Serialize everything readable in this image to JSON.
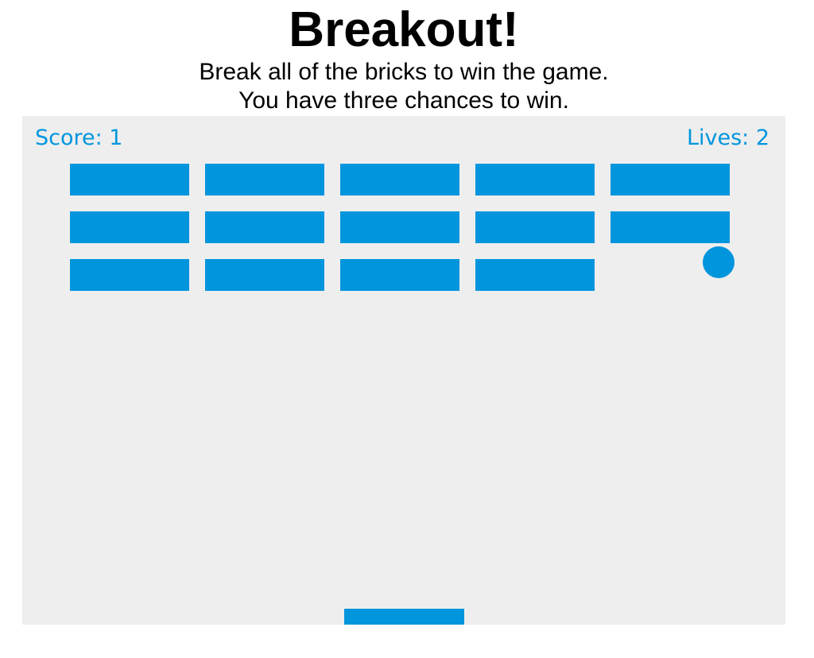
{
  "header": {
    "title": "Breakout!",
    "line1": "Break all of the bricks to win the game.",
    "line2": "You have three chances to win."
  },
  "game": {
    "score_text": "Score: 1",
    "lives_text": "Lives: 2",
    "colors": {
      "background": "#eeeeee",
      "accent": "#0095dd"
    },
    "brick_rows": 3,
    "brick_columns": 5,
    "bricks_present": [
      [
        true,
        true,
        true,
        true,
        true
      ],
      [
        true,
        true,
        true,
        true,
        true
      ],
      [
        true,
        true,
        true,
        true,
        false
      ]
    ]
  }
}
